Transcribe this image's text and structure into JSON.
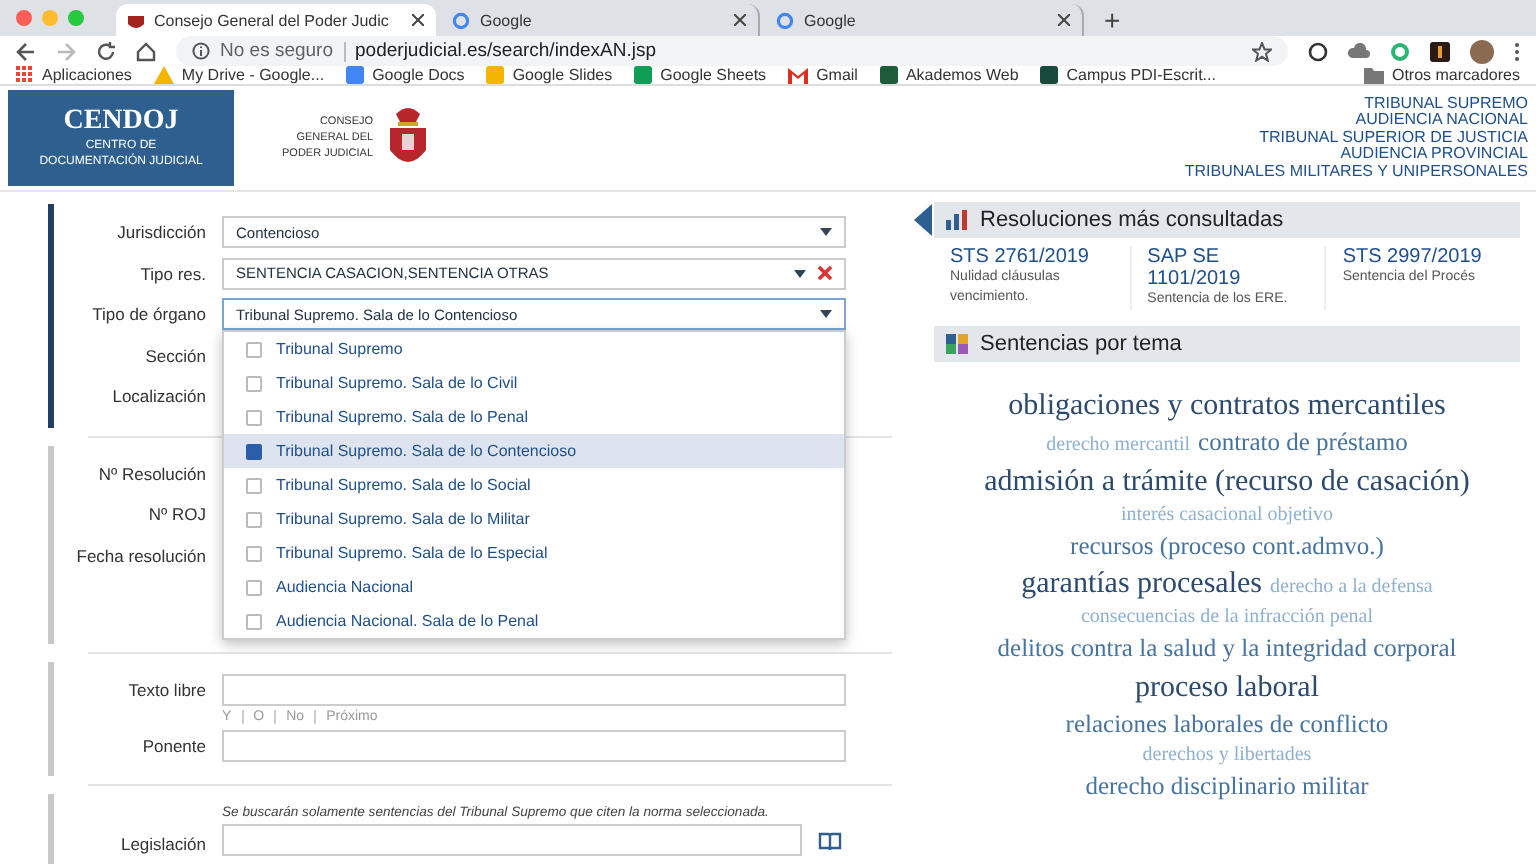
{
  "browser": {
    "tabs": [
      {
        "title": "Consejo General del Poder Judic",
        "selected": true
      },
      {
        "title": "Google",
        "selected": false
      },
      {
        "title": "Google",
        "selected": false
      }
    ],
    "new_tab": "+",
    "security": "No es seguro",
    "url": "poderjudicial.es/search/indexAN.jsp",
    "bookmarks": [
      {
        "label": "Aplicaciones",
        "kind": "apps",
        "color": "#e8453c"
      },
      {
        "label": "My Drive - Google...",
        "kind": "drive",
        "color": "#f4b400"
      },
      {
        "label": "Google Docs",
        "kind": "site",
        "color": "#4285f4"
      },
      {
        "label": "Google Slides",
        "kind": "site",
        "color": "#f4b400"
      },
      {
        "label": "Google Sheets",
        "kind": "site",
        "color": "#0f9d58"
      },
      {
        "label": "Gmail",
        "kind": "mail",
        "color": "#d93025"
      },
      {
        "label": "Akademos Web",
        "kind": "site",
        "color": "#1e5b3a"
      },
      {
        "label": "Campus PDI-Escrit...",
        "kind": "site",
        "color": "#174a3a"
      }
    ],
    "other_bookmarks": "Otros marcadores"
  },
  "header": {
    "logo_title": "CENDOJ",
    "logo_lines": [
      "CENTRO DE",
      "DOCUMENTACIÓN JUDICIAL"
    ],
    "council_lines": [
      "CONSEJO",
      "GENERAL DEL",
      "PODER JUDICIAL"
    ],
    "courts": [
      "TRIBUNAL SUPREMO",
      "AUDIENCIA NACIONAL",
      "TRIBUNAL SUPERIOR DE JUSTICIA",
      "AUDIENCIA PROVINCIAL",
      "TRIBUNALES MILITARES Y UNIPERSONALES"
    ]
  },
  "form": {
    "sections": [
      {
        "kind": "primary",
        "rows": [
          {
            "label": "Jurisdicción",
            "kind": "select",
            "value": "Contencioso",
            "clearable": false,
            "open": false
          },
          {
            "label": "Tipo res.",
            "kind": "select",
            "value": "SENTENCIA CASACION,SENTENCIA OTRAS",
            "clearable": true,
            "open": false
          },
          {
            "label": "Tipo de órgano",
            "kind": "select",
            "value": "Tribunal Supremo. Sala de lo Contencioso",
            "clearable": false,
            "open": true,
            "options": [
              {
                "label": "Tribunal Supremo",
                "checked": false,
                "selected": false
              },
              {
                "label": "Tribunal Supremo. Sala de lo Civil",
                "checked": false,
                "selected": false
              },
              {
                "label": "Tribunal Supremo. Sala de lo Penal",
                "checked": false,
                "selected": false
              },
              {
                "label": "Tribunal Supremo. Sala de lo Contencioso",
                "checked": true,
                "selected": true
              },
              {
                "label": "Tribunal Supremo. Sala de lo Social",
                "checked": false,
                "selected": false
              },
              {
                "label": "Tribunal Supremo. Sala de lo Militar",
                "checked": false,
                "selected": false
              },
              {
                "label": "Tribunal Supremo. Sala de lo Especial",
                "checked": false,
                "selected": false
              },
              {
                "label": "Audiencia Nacional",
                "checked": false,
                "selected": false
              },
              {
                "label": "Audiencia Nacional. Sala de lo Penal",
                "checked": false,
                "selected": false
              }
            ]
          },
          {
            "label": "Sección",
            "kind": "input"
          },
          {
            "label": "Localización",
            "kind": "input"
          }
        ]
      },
      {
        "kind": "secondary",
        "rows": [
          {
            "label": "Nº Resolución",
            "kind": "input"
          },
          {
            "label": "Nº ROJ",
            "kind": "input"
          },
          {
            "label": "Fecha resolución",
            "kind": "input"
          }
        ]
      },
      {
        "kind": "secondary",
        "rows": [
          {
            "label": "Texto libre",
            "kind": "input",
            "operators": [
              "Y",
              "O",
              "No",
              "Próximo"
            ]
          },
          {
            "label": "Ponente",
            "kind": "input"
          }
        ]
      },
      {
        "kind": "secondary",
        "rows": [
          {
            "label": "Legislación",
            "kind": "lookup",
            "note": "Se buscarán solamente sentencias del Tribunal Supremo que citen la norma seleccionada."
          }
        ]
      }
    ]
  },
  "most_viewed": {
    "title": "Resoluciones más consultadas",
    "items": [
      {
        "ref": "STS 2761/2019",
        "description": "Nulidad cláusulas vencimiento."
      },
      {
        "ref": "SAP SE 1101/2019",
        "description": "Sentencia de los ERE."
      },
      {
        "ref": "STS 2997/2019",
        "description": "Sentencia del Procés"
      }
    ]
  },
  "topics": {
    "title": "Sentencias por tema",
    "lines": [
      [
        {
          "text": "obligaciones y contratos mercantiles",
          "kind": "major"
        }
      ],
      [
        {
          "text": "derecho mercantil",
          "kind": "minor"
        },
        {
          "text": "contrato de préstamo",
          "kind": "medium"
        }
      ],
      [
        {
          "text": "admisión a trámite (recurso de casación)",
          "kind": "major"
        }
      ],
      [
        {
          "text": "interés casacional objetivo",
          "kind": "minor"
        }
      ],
      [
        {
          "text": "recursos (proceso cont.admvo.)",
          "kind": "medium"
        }
      ],
      [
        {
          "text": "garantías procesales",
          "kind": "major"
        },
        {
          "text": "derecho a la defensa",
          "kind": "minor"
        }
      ],
      [
        {
          "text": "consecuencias de la infracción penal",
          "kind": "minor"
        }
      ],
      [
        {
          "text": "delitos contra la salud y la integridad corporal",
          "kind": "medium"
        }
      ],
      [
        {
          "text": "proceso laboral",
          "kind": "major"
        }
      ],
      [
        {
          "text": "relaciones laborales de conflicto",
          "kind": "medium"
        }
      ],
      [
        {
          "text": "derechos y libertades",
          "kind": "minor"
        }
      ],
      [
        {
          "text": "derecho disciplinario militar",
          "kind": "medium"
        }
      ]
    ]
  }
}
